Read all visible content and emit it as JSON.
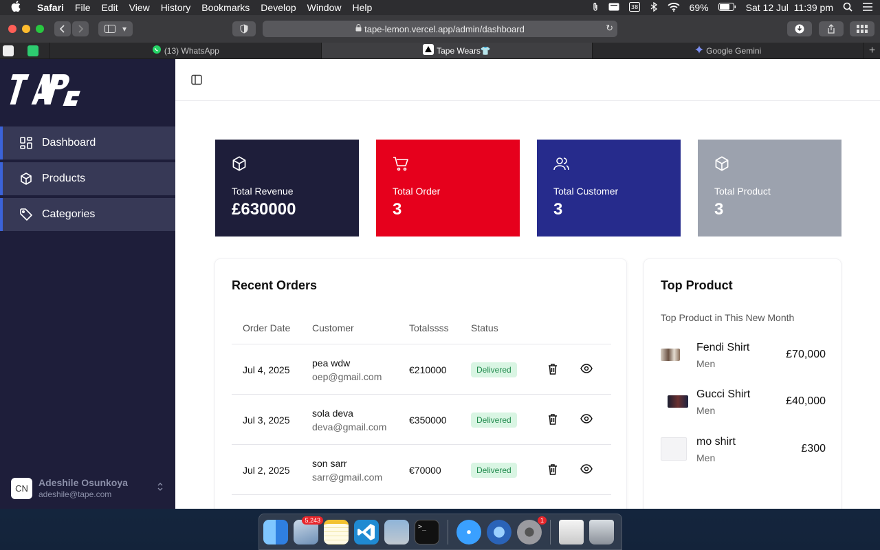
{
  "menubar": {
    "app_name": "Safari",
    "items": [
      "File",
      "Edit",
      "View",
      "History",
      "Bookmarks",
      "Develop",
      "Window",
      "Help"
    ],
    "battery": "69%",
    "datetime": "Sat 12 Jul  11:39 pm"
  },
  "browser": {
    "url": "tape-lemon.vercel.app/admin/dashboard",
    "tabs": [
      {
        "label": "(13) WhatsApp"
      },
      {
        "label": "Tape Wears👕"
      },
      {
        "label": "Google Gemini"
      }
    ]
  },
  "sidebar": {
    "logo_text": "TAPE",
    "items": [
      {
        "label": "Dashboard"
      },
      {
        "label": "Products"
      },
      {
        "label": "Categories"
      }
    ],
    "user": {
      "initials": "CN",
      "name": "Adeshile Osunkoya",
      "email": "adeshile@tape.com"
    }
  },
  "stats": [
    {
      "label": "Total Revenue",
      "value": "£630000",
      "color": "#1e1e3a"
    },
    {
      "label": "Total Order",
      "value": "3",
      "color": "#e6001c"
    },
    {
      "label": "Total Customer",
      "value": "3",
      "color": "#262b8c"
    },
    {
      "label": "Total Product",
      "value": "3",
      "color": "#9ca2ae"
    }
  ],
  "recent_orders": {
    "title": "Recent Orders",
    "columns": [
      "Order Date",
      "Customer",
      "Totalssss",
      "Status"
    ],
    "rows": [
      {
        "date": "Jul 4, 2025",
        "name": "pea wdw",
        "email": "oep@gmail.com",
        "total": "€210000",
        "status": "Delivered"
      },
      {
        "date": "Jul 3, 2025",
        "name": "sola deva",
        "email": "deva@gmail.com",
        "total": "€350000",
        "status": "Delivered"
      },
      {
        "date": "Jul 2, 2025",
        "name": "son sarr",
        "email": "sarr@gmail.com",
        "total": "€70000",
        "status": "Delivered"
      }
    ]
  },
  "top_product": {
    "title": "Top Product",
    "subtitle": "Top Product in This New Month",
    "items": [
      {
        "name": "Fendi Shirt",
        "category": "Men",
        "price": "£70,000"
      },
      {
        "name": "Gucci Shirt",
        "category": "Men",
        "price": "£40,000"
      },
      {
        "name": "mo shirt",
        "category": "Men",
        "price": "£300"
      }
    ]
  },
  "dock": {
    "mail_badge": "5,243",
    "settings_badge": "1"
  }
}
